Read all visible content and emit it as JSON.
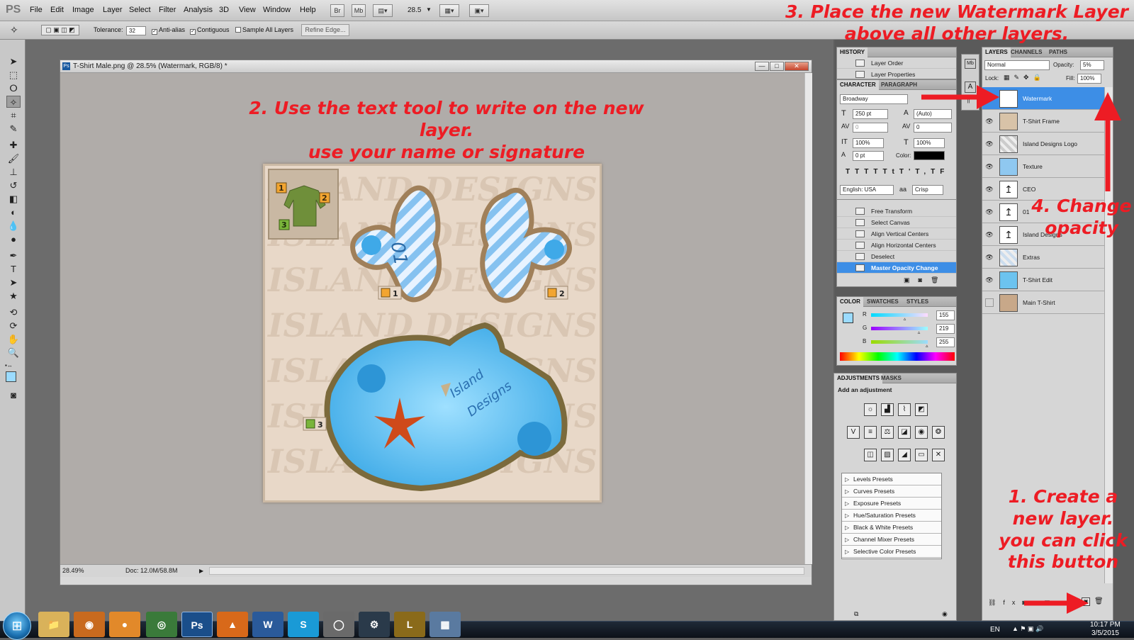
{
  "app": {
    "logo": "PS"
  },
  "menus": [
    "File",
    "Edit",
    "Image",
    "Layer",
    "Select",
    "Filter",
    "Analysis",
    "3D",
    "View",
    "Window",
    "Help"
  ],
  "menubar_buttons": {
    "br": "Br",
    "mb": "Mb",
    "zoom": "28.5"
  },
  "options": {
    "tolerance_label": "Tolerance:",
    "tolerance_value": "32",
    "anti_alias": "Anti-alias",
    "contiguous": "Contiguous",
    "sample_all": "Sample All Layers",
    "refine_edge": "Refine Edge..."
  },
  "document": {
    "title": "T-Shirt Male.png @ 28.5% (Watermark, RGB/8) *",
    "zoom": "28.49%",
    "doc_size": "Doc: 12.0M/58.8M"
  },
  "artwork": {
    "watermark": "ISLAND DESIGNS",
    "badge_1": "1",
    "badge_2": "2",
    "badge_3": "3",
    "logo_script_line1": "Island",
    "logo_script_line2": "Designs"
  },
  "annotations": {
    "step2_line1": "2. Use the text tool to write on the new layer.",
    "step2_line2": "use your name or signature",
    "step3_line1": "3. Place the new Watermark Layer",
    "step3_line2": "above all other layers.",
    "step4_line1": "4. Change",
    "step4_line2": "opacity",
    "step1_line1": "1. Create a",
    "step1_line2": "new layer.",
    "step1_line3": "you can click",
    "step1_line4": "this button"
  },
  "history": {
    "tab": "HISTORY",
    "top_items": [
      "Layer Order",
      "Layer Properties"
    ],
    "items": [
      "Free Transform",
      "Select Canvas",
      "Align Vertical Centers",
      "Align Horizontal Centers",
      "Deselect",
      "Master Opacity Change"
    ]
  },
  "character": {
    "tab_character": "CHARACTER",
    "tab_paragraph": "PARAGRAPH",
    "font": "Broadway",
    "size": "250 pt",
    "leading": "(Auto)",
    "kerning": "0",
    "tracking": "0",
    "vscale": "100%",
    "hscale": "100%",
    "baseline": "0 pt",
    "color_label": "Color:",
    "language": "English: USA",
    "antialias_glyph": "aa",
    "antialias": "Crisp",
    "style_buttons": [
      "T",
      "T",
      "TT",
      "Tt",
      "T'",
      "T,",
      "T",
      "F"
    ]
  },
  "color_panel": {
    "tabs": [
      "COLOR",
      "SWATCHES",
      "STYLES"
    ],
    "r_label": "R",
    "g_label": "G",
    "b_label": "B",
    "r": "155",
    "g": "219",
    "b": "255",
    "r_fraction": 0.61,
    "g_fraction": 0.86,
    "b_fraction": 1.0,
    "swatch": "#9bdbff"
  },
  "adjustments": {
    "tabs": [
      "ADJUSTMENTS",
      "MASKS"
    ],
    "heading": "Add an adjustment",
    "presets": [
      "Levels Presets",
      "Curves Presets",
      "Exposure Presets",
      "Hue/Saturation Presets",
      "Black & White Presets",
      "Channel Mixer Presets",
      "Selective Color Presets"
    ]
  },
  "layers_panel": {
    "tabs": [
      "LAYERS",
      "CHANNELS",
      "PATHS"
    ],
    "blend_mode": "Normal",
    "opacity_label": "Opacity:",
    "opacity": "5%",
    "lock_label": "Lock:",
    "fill_label": "Fill:",
    "fill": "100%",
    "layers": [
      {
        "name": "Watermark",
        "thumb": "T",
        "selected": true
      },
      {
        "name": "T-Shirt Frame",
        "thumb": "",
        "selected": false
      },
      {
        "name": "Island Designs Logo",
        "thumb": "",
        "selected": false
      },
      {
        "name": "Texture",
        "thumb": "",
        "selected": false
      },
      {
        "name": "CEO",
        "thumb": "↥",
        "selected": false
      },
      {
        "name": "01",
        "thumb": "↥",
        "selected": false
      },
      {
        "name": "Island Designs",
        "thumb": "↥",
        "selected": false
      },
      {
        "name": "Extras",
        "thumb": "",
        "selected": false
      },
      {
        "name": "T-Shirt Edit",
        "thumb": "",
        "selected": false
      },
      {
        "name": "Main T-Shirt",
        "thumb": "",
        "selected": false
      }
    ]
  },
  "taskbar": {
    "lang": "EN",
    "time": "10:17 PM",
    "date": "3/5/2015",
    "apps": [
      "Ps",
      "W",
      "S"
    ]
  },
  "colors": {
    "accent": "#3d8ee6",
    "annotation": "#ed1c24",
    "pool": "#4fb6ee"
  }
}
